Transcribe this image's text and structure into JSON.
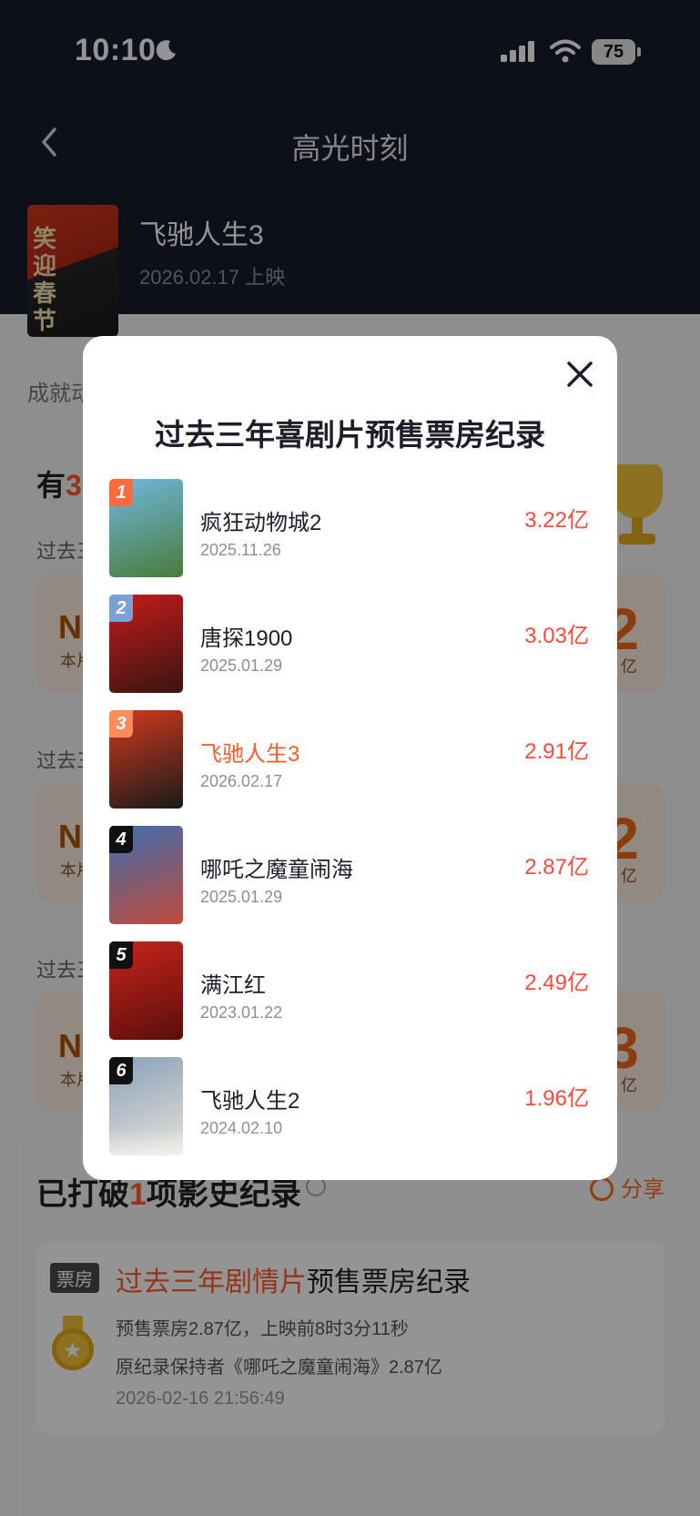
{
  "status_bar": {
    "time": "10:10",
    "battery": "75"
  },
  "nav": {
    "title": "高光时刻"
  },
  "movie": {
    "name": "飞驰人生3",
    "release": "2026.02.17 上映",
    "poster_text": "笑迎春节"
  },
  "background": {
    "section_label": "成就动",
    "count_heading_prefix": "有",
    "count_heading_num": "3",
    "sub_label": "过去三",
    "cards": [
      {
        "no": "NO",
        "sub": "本片",
        "big": "2",
        "unit": "亿"
      },
      {
        "no": "NO",
        "sub": "本片",
        "big": "2",
        "unit": "亿"
      },
      {
        "no": "NO",
        "sub": "本片",
        "big": "3",
        "unit": "亿"
      }
    ]
  },
  "records": {
    "heading_prefix": "已打破",
    "heading_num": "1",
    "heading_suffix": "项影史纪录",
    "share": "分享",
    "card": {
      "badge": "票房",
      "title_highlight": "过去三年剧情片",
      "title_rest": "预售票房纪录",
      "line1": "预售票房2.87亿，上映前8时3分11秒",
      "line2": "原纪录保持者《哪吒之魔童闹海》2.87亿",
      "time": "2026-02-16 21:56:49"
    }
  },
  "modal": {
    "title": "过去三年喜剧片预售票房纪录",
    "items": [
      {
        "rank": "1",
        "title": "疯狂动物城2",
        "date": "2025.11.26",
        "value": "3.22亿",
        "badge_color": "#ff6a3d",
        "poster_colors": [
          "#6fb9e0",
          "#4a7a3a"
        ]
      },
      {
        "rank": "2",
        "title": "唐探1900",
        "date": "2025.01.29",
        "value": "3.03亿",
        "badge_color": "#7aa0d8",
        "poster_colors": [
          "#c41c1c",
          "#3a1410"
        ]
      },
      {
        "rank": "3",
        "title": "飞驰人生3",
        "date": "2026.02.17",
        "value": "2.91亿",
        "badge_color": "#ff8a5a",
        "poster_colors": [
          "#d23a1e",
          "#1a1a1a"
        ],
        "highlight": true
      },
      {
        "rank": "4",
        "title": "哪吒之魔童闹海",
        "date": "2025.01.29",
        "value": "2.87亿",
        "badge_color": "#111111",
        "poster_colors": [
          "#3b6fb0",
          "#c04a3a"
        ]
      },
      {
        "rank": "5",
        "title": "满江红",
        "date": "2023.01.22",
        "value": "2.49亿",
        "badge_color": "#111111",
        "poster_colors": [
          "#c8241c",
          "#5a0e0a"
        ]
      },
      {
        "rank": "6",
        "title": "飞驰人生2",
        "date": "2024.02.10",
        "value": "1.96亿",
        "badge_color": "#111111",
        "poster_colors": [
          "#8aa0b8",
          "#e6e2da"
        ]
      }
    ]
  }
}
